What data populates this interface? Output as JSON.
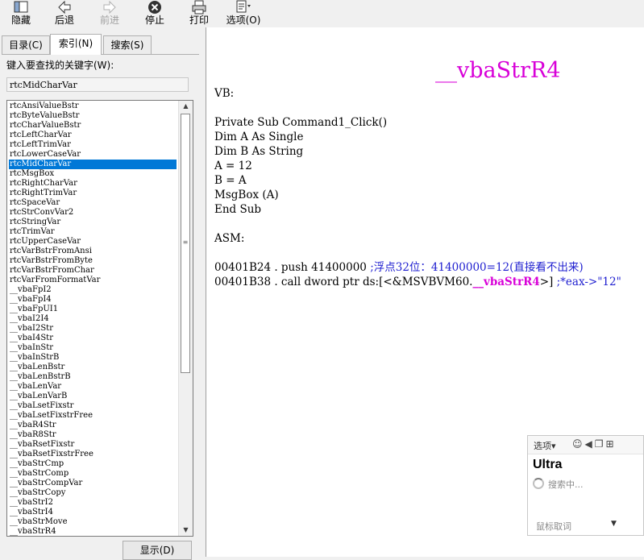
{
  "toolbar": {
    "hide": {
      "label": "隐藏",
      "icon": "hide-pane-icon"
    },
    "back": {
      "label": "后退",
      "icon": "back-arrow-icon"
    },
    "forward": {
      "label": "前进",
      "icon": "forward-arrow-icon"
    },
    "stop": {
      "label": "停止",
      "icon": "stop-icon"
    },
    "print": {
      "label": "打印",
      "icon": "printer-icon"
    },
    "options": {
      "label": "选项(O)",
      "icon": "options-icon"
    }
  },
  "tabs": {
    "contents": "目录(C)",
    "index": "索引(N)",
    "search": "搜索(S)"
  },
  "keyword": {
    "label": "键入要查找的关键字(W):",
    "value": "rtcMidCharVar"
  },
  "index_list": {
    "selected": "rtcMidCharVar",
    "items": [
      "rtcAnsiValueBstr",
      "rtcByteValueBstr",
      "rtcCharValueBstr",
      "rtcLeftCharVar",
      "rtcLeftTrimVar",
      "rtcLowerCaseVar",
      "rtcMidCharVar",
      "rtcMsgBox",
      "rtcRightCharVar",
      "rtcRightTrimVar",
      "rtcSpaceVar",
      "rtcStrConvVar2",
      "rtcStringVar",
      "rtcTrimVar",
      "rtcUpperCaseVar",
      "rtcVarBstrFromAnsi",
      "rtcVarBstrFromByte",
      "rtcVarBstrFromChar",
      "rtcVarFromFormatVar",
      "__vbaFpI2",
      "__vbaFpI4",
      "__vbaFpUI1",
      "__vbaI2I4",
      "__vbaI2Str",
      "__vbaI4Str",
      "__vbaInStr",
      "__vbaInStrB",
      "__vbaLenBstr",
      "__vbaLenBstrB",
      "__vbaLenVar",
      "__vbaLenVarB",
      "__vbaLsetFixstr",
      "__vbaLsetFixstrFree",
      "__vbaR4Str",
      "__vbaR8Str",
      "__vbaRsetFixstr",
      "__vbaRsetFixstrFree",
      "__vbaStrCmp",
      "__vbaStrComp",
      "__vbaStrCompVar",
      "__vbaStrCopy",
      "__vbaStrI2",
      "__vbaStrI4",
      "__vbaStrMove",
      "__vbaStrR4"
    ]
  },
  "show_button": "显示(D)",
  "document": {
    "title": "__vbaStrR4",
    "vb_label": "VB:",
    "vb_code": [
      "Private Sub Command1_Click()",
      "Dim A As Single",
      "Dim B As String",
      "A = 12",
      "B = A",
      "MsgBox (A)",
      "End Sub"
    ],
    "asm_label": "ASM:",
    "asm_line1": {
      "code": "00401B24 . push 41400000 ",
      "comment": ";浮点32位：41400000=12(直接看不出来)"
    },
    "asm_line2": {
      "prefix": "00401B38 . call dword ptr ds:[<&MSVBVM60.",
      "func": "__vbaStrR4",
      "suffix": ">] ",
      "comment": ";*eax->\"12\""
    }
  },
  "ime_popup": {
    "options": "选项▾",
    "word": "Ultra",
    "status": "搜索中...",
    "footer": "鼠标取词"
  }
}
